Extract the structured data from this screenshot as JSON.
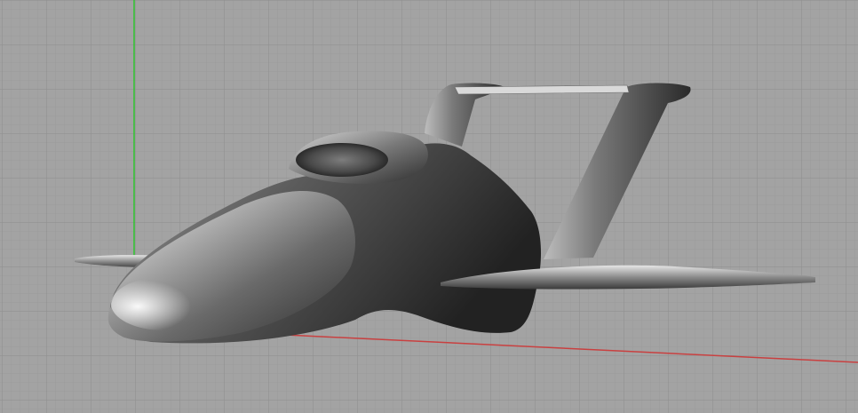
{
  "viewport": {
    "background": "#a3a3a3",
    "grid_minor_color": "#9a9a9a",
    "grid_major_color": "#8d8d8d",
    "axis_y_color": "#2ec42e",
    "axis_x_color": "#c94040",
    "model_color": "#5a5a5a",
    "highlight_color": "#f2f2f2"
  }
}
